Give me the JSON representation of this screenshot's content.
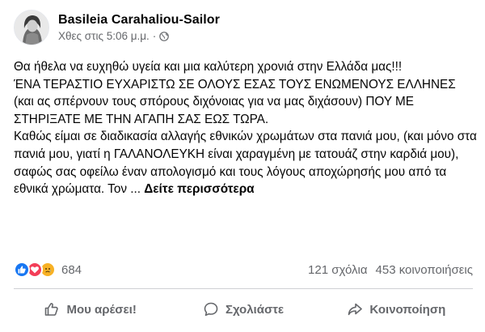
{
  "post": {
    "author": "Basileia Carahaliou-Sailor",
    "timestamp": "Χθες στις 5:06 μ.μ.",
    "separator": "·",
    "privacy_icon": "globe-icon",
    "text": "Θα ήθελα να ευχηθώ υγεία και μια καλύτερη χρονιά στην Ελλάδα μας!!!\nΈΝΑ ΤΕΡΑΣΤΙΟ ΕΥΧΑΡΙΣΤΩ ΣΕ ΟΛΟΥΣ ΕΣΑΣ ΤΟΥΣ ΕΝΩΜΕΝΟΥΣ ΕΛΛΗΝΕΣ (και ας σπέρνουν τους σπόρους διχόνοιας για να μας διχάσουν) ΠΟΥ ΜΕ ΣΤΗΡΙΞΑΤΕ ΜΕ ΤΗΝ ΑΓΑΠΗ ΣΑΣ ΕΩΣ ΤΩΡΑ.\nΚαθώς είμαι σε διαδικασία αλλαγής εθνικών χρωμάτων στα πανιά μου, (και μόνο στα πανιά μου, γιατί η ΓΑΛΑΝΟΛΕΥΚΗ είναι χαραγμένη με τατουάζ στην καρδιά μου), σαφώς σας οφείλω έναν απολογισμό και τους λόγους αποχώρησής μου από τα εθνικά χρώματα. Τον ...",
    "see_more": "Δείτε περισσότερα"
  },
  "reactions": {
    "icons": [
      "like-icon",
      "love-icon",
      "sad-icon"
    ],
    "count": "684",
    "comments": "121 σχόλια",
    "shares": "453 κοινοποιήσεις"
  },
  "actions": {
    "like": "Μου αρέσει!",
    "comment": "Σχολιάστε",
    "share": "Κοινοποίηση"
  },
  "colors": {
    "like": "#1877f2",
    "love": "#f33e58",
    "sad": "#f7b125",
    "secondary_text": "#65676b"
  }
}
